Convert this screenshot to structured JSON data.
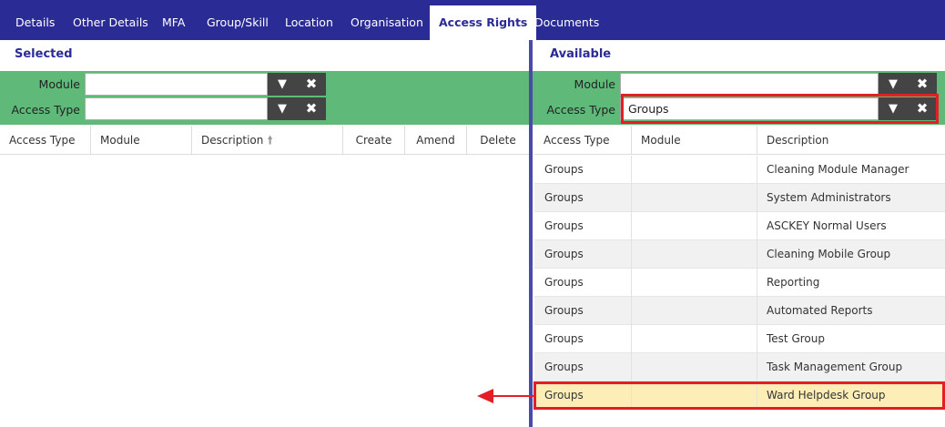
{
  "tabs": [
    {
      "label": "Details"
    },
    {
      "label": "Other Details"
    },
    {
      "label": "MFA"
    },
    {
      "label": "Group/Skill"
    },
    {
      "label": "Location"
    },
    {
      "label": "Organisation"
    },
    {
      "label": "Access Rights"
    },
    {
      "label": "Documents"
    }
  ],
  "selected": {
    "title": "Selected",
    "module_label": "Module",
    "module_value": "",
    "access_type_label": "Access Type",
    "access_type_value": "",
    "columns": [
      "Access Type",
      "Module",
      "Description",
      "Create",
      "Amend",
      "Delete"
    ],
    "rows": []
  },
  "available": {
    "title": "Available",
    "module_label": "Module",
    "module_value": "",
    "access_type_label": "Access Type",
    "access_type_value": "Groups",
    "columns": [
      "Access Type",
      "Module",
      "Description"
    ],
    "rows": [
      {
        "access_type": "Groups",
        "module": "",
        "description": "Cleaning Module Manager"
      },
      {
        "access_type": "Groups",
        "module": "",
        "description": "System Administrators"
      },
      {
        "access_type": "Groups",
        "module": "",
        "description": "ASCKEY Normal Users"
      },
      {
        "access_type": "Groups",
        "module": "",
        "description": "Cleaning Mobile Group"
      },
      {
        "access_type": "Groups",
        "module": "",
        "description": "Reporting"
      },
      {
        "access_type": "Groups",
        "module": "",
        "description": "Automated Reports"
      },
      {
        "access_type": "Groups",
        "module": "",
        "description": "Test Group"
      },
      {
        "access_type": "Groups",
        "module": "",
        "description": "Task Management Group"
      },
      {
        "access_type": "Groups",
        "module": "",
        "description": "Ward Helpdesk Group"
      }
    ]
  },
  "icons": {
    "dropdown": "caret-down-icon",
    "clear": "close-icon",
    "sort": "sort-ascending-icon",
    "annotation_arrow": "arrow-left-icon"
  },
  "colors": {
    "tabbar": "#2b2b96",
    "filter_bar": "#5fba7a",
    "button": "#444444",
    "highlight_row": "#fdeeb8",
    "annotation": "#e31e24"
  }
}
